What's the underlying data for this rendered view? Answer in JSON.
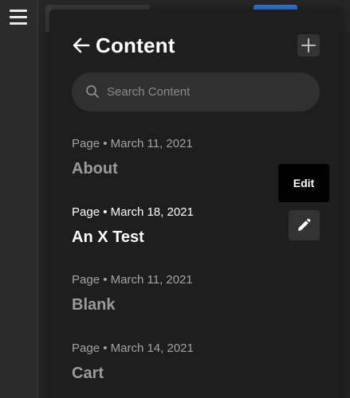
{
  "panel": {
    "title": "Content",
    "search_placeholder": "Search Content"
  },
  "items": [
    {
      "meta": "Page • March 11, 2021",
      "title": "About"
    },
    {
      "meta": "Page • March 18, 2021",
      "title": "An X Test"
    },
    {
      "meta": "Page • March 11, 2021",
      "title": "Blank"
    },
    {
      "meta": "Page • March 14, 2021",
      "title": "Cart"
    }
  ],
  "edit": {
    "tooltip": "Edit"
  },
  "icons": {
    "menu": "hamburger-menu-icon",
    "back": "arrow-left-icon",
    "add": "plus-icon",
    "search": "search-icon",
    "edit": "pencil-icon"
  },
  "colors": {
    "panel_bg": "#1e1e1e",
    "accent_blue": "#2e7dd7"
  }
}
